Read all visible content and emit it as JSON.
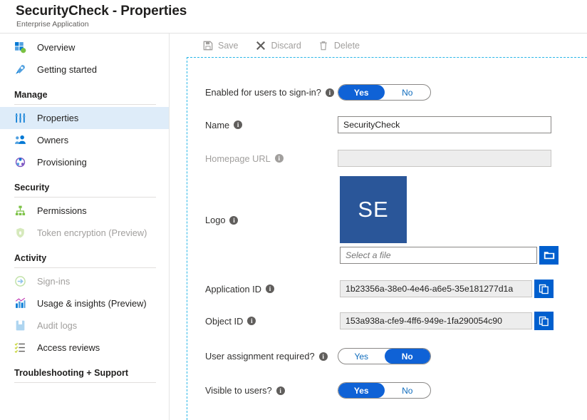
{
  "header": {
    "title": "SecurityCheck - Properties",
    "subtitle": "Enterprise Application"
  },
  "sidebar": {
    "collapse_glyph": "«",
    "items": [
      {
        "label": "Overview",
        "icon": "grid-icon",
        "state": "normal"
      },
      {
        "label": "Getting started",
        "icon": "rocket-icon",
        "state": "normal"
      },
      {
        "label": "Manage",
        "icon": "",
        "state": "group"
      },
      {
        "label": "Properties",
        "icon": "sliders-icon",
        "state": "selected"
      },
      {
        "label": "Owners",
        "icon": "people-icon",
        "state": "normal"
      },
      {
        "label": "Provisioning",
        "icon": "provisioning-icon",
        "state": "normal"
      },
      {
        "label": "Security",
        "icon": "",
        "state": "group"
      },
      {
        "label": "Permissions",
        "icon": "hierarchy-icon",
        "state": "normal"
      },
      {
        "label": "Token encryption (Preview)",
        "icon": "shield-icon",
        "state": "disabled"
      },
      {
        "label": "Activity",
        "icon": "",
        "state": "group"
      },
      {
        "label": "Sign-ins",
        "icon": "signin-arrow-icon",
        "state": "disabled"
      },
      {
        "label": "Usage & insights (Preview)",
        "icon": "bar-chart-icon",
        "state": "normal"
      },
      {
        "label": "Audit logs",
        "icon": "book-icon",
        "state": "disabled"
      },
      {
        "label": "Access reviews",
        "icon": "checklist-icon",
        "state": "normal"
      },
      {
        "label": "Troubleshooting + Support",
        "icon": "",
        "state": "group"
      }
    ]
  },
  "toolbar": {
    "save_label": "Save",
    "discard_label": "Discard",
    "delete_label": "Delete"
  },
  "form": {
    "enabled_signin": {
      "label": "Enabled for users to sign-in?",
      "yes": "Yes",
      "no": "No",
      "value": "Yes"
    },
    "name": {
      "label": "Name",
      "value": "SecurityCheck"
    },
    "homepage_url": {
      "label": "Homepage URL",
      "value": ""
    },
    "logo": {
      "label": "Logo",
      "initials": "SE",
      "file_placeholder": "Select a file",
      "file_value": "",
      "browse_icon": "folder-icon"
    },
    "application_id": {
      "label": "Application ID",
      "value": "1b23356a-38e0-4e46-a6e5-35e181277d1a",
      "copy_icon": "copy-icon"
    },
    "object_id": {
      "label": "Object ID",
      "value": "153a938a-cfe9-4ff6-949e-1fa290054c90",
      "copy_icon": "copy-icon"
    },
    "user_assignment": {
      "label": "User assignment required?",
      "yes": "Yes",
      "no": "No",
      "value": "No"
    },
    "visible_to_users": {
      "label": "Visible to users?",
      "yes": "Yes",
      "no": "No",
      "value": "Yes"
    },
    "info_glyph": "i"
  },
  "colors": {
    "accent": "#0f62d6",
    "button_blue": "#005fce",
    "logo_blue": "#2a5699",
    "selected_nav": "#deecf9",
    "dashed_border": "#29b6e8"
  }
}
